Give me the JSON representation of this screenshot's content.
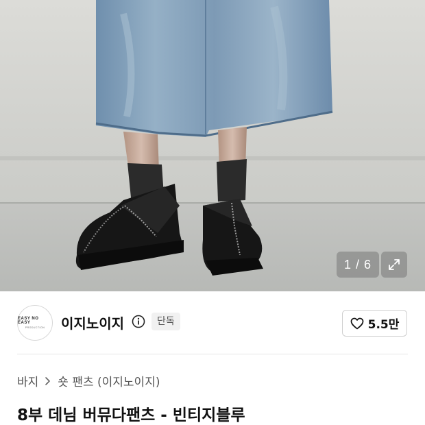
{
  "gallery": {
    "counter": "1 / 6",
    "expand_icon": "expand-icon"
  },
  "brand": {
    "logo_text": "EASY NO EASY",
    "logo_subtext": "PRODUCTION",
    "name": "이지노이지",
    "info_icon": "info-icon",
    "badge": "단독",
    "like_count": "5.5만",
    "like_icon": "heart-icon"
  },
  "breadcrumb": {
    "category": "바지",
    "subcategory": "숏 팬츠 (이지노이지)",
    "separator_icon": "chevron-right-icon"
  },
  "product": {
    "title": "8부 데님 버뮤다팬츠 - 빈티지블루"
  },
  "colors": {
    "text_primary": "#111111",
    "text_secondary": "#555555",
    "badge_bg": "#f1f1f1",
    "overlay": "rgba(120,120,120,0.55)"
  }
}
